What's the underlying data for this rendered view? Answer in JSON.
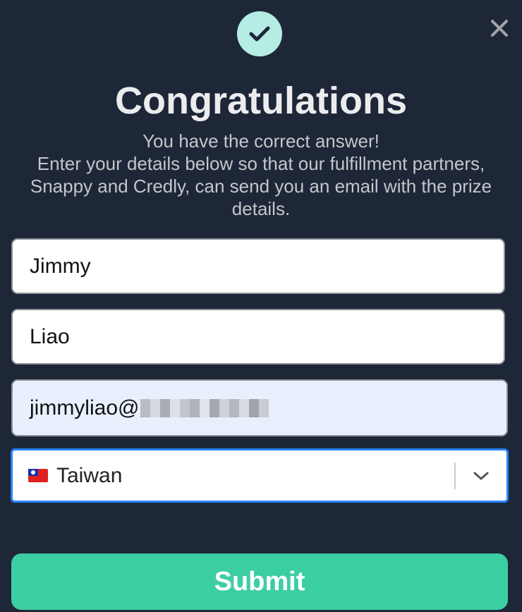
{
  "header": {
    "badge_icon": "check-icon",
    "close_icon": "close-icon"
  },
  "title": "Congratulations",
  "subtitle": {
    "line1": "You have the correct answer!",
    "line2": "Enter your details below so that our fulfillment partners, Snappy and Credly, can send you an email with the prize details."
  },
  "form": {
    "first_name": "Jimmy",
    "last_name": "Liao",
    "email_visible": "jimmyliao@",
    "country": "Taiwan",
    "country_flag_icon": "taiwan-flag-icon",
    "submit_label": "Submit"
  },
  "colors": {
    "background": "#1e2738",
    "badge": "#b5ece4",
    "submit": "#3ccea3",
    "focus_border": "#2684ff",
    "autofill_bg": "#e8f0fe"
  }
}
